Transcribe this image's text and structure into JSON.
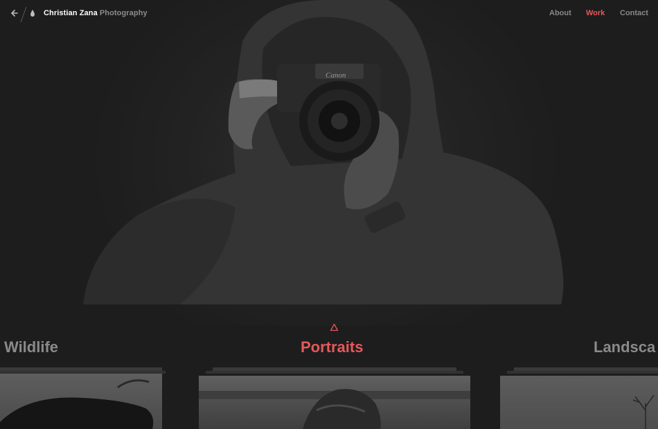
{
  "header": {
    "brand_name": "Christian Zana",
    "brand_sub": "Photography",
    "back_icon": "arrow-left-icon",
    "logo_icon": "drop-icon"
  },
  "nav": {
    "items": [
      {
        "label": "About",
        "active": false
      },
      {
        "label": "Work",
        "active": true
      },
      {
        "label": "Contact",
        "active": false
      }
    ]
  },
  "categories": {
    "previous": "Wildlife",
    "current": "Portraits",
    "next": "Landsca",
    "indicator_icon": "triangle-up-icon"
  },
  "hero": {
    "camera_brand": "Canon"
  },
  "colors": {
    "background": "#1d1d1d",
    "accent": "#e8585a",
    "muted": "#8a8a8a",
    "white": "#ffffff"
  }
}
